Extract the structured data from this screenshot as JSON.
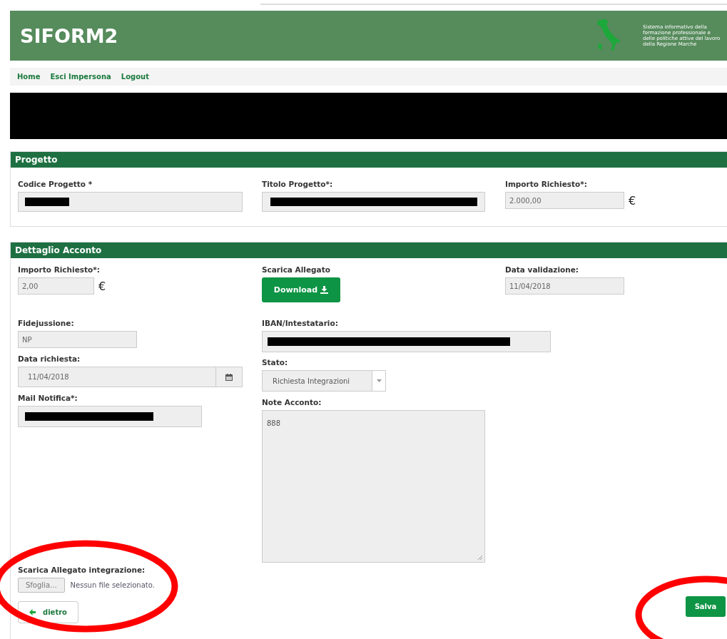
{
  "header": {
    "title": "SIFORM2",
    "tagline": "Sistema informativo della formazione professionale e delle politiche attive del lavoro della Regione Marche"
  },
  "nav": [
    {
      "label": "Home"
    },
    {
      "label": "Esci Impersona"
    },
    {
      "label": "Logout"
    }
  ],
  "progetto": {
    "title": "Progetto",
    "codice": {
      "label": "Codice Progetto *",
      "kind": "redacted"
    },
    "titolo": {
      "label": "Titolo Progetto*:",
      "kind": "redacted"
    },
    "importo": {
      "label": "Importo Richiesto*:",
      "value": "2.000,00",
      "currency": "€"
    }
  },
  "dettaglio": {
    "title": "Dettaglio Acconto",
    "importo": {
      "label": "Importo Richiesto*:",
      "value": "2,00",
      "currency": "€"
    },
    "scarica": {
      "label": "Scarica Allegato",
      "button": "Download"
    },
    "data_validazione": {
      "label": "Data validazione:",
      "value": "11/04/2018"
    },
    "fidejussione": {
      "label": "Fidejussione:",
      "value": "NP"
    },
    "iban": {
      "label": "IBAN/Intestatario:",
      "kind": "redacted"
    },
    "data_richiesta": {
      "label": "Data richiesta:",
      "value": "11/04/2018"
    },
    "stato": {
      "label": "Stato:",
      "value": "Richiesta Integrazioni"
    },
    "mail": {
      "label": "Mail Notifica*:",
      "kind": "redacted"
    },
    "note": {
      "label": "Note Acconto:",
      "value": "888"
    },
    "integrazione": {
      "label": "Scarica Allegato integrazione:",
      "browse_button": "Sfoglia...",
      "no_file": "Nessun file selezionato."
    },
    "back_button": "dietro",
    "save_button": "Salva"
  }
}
